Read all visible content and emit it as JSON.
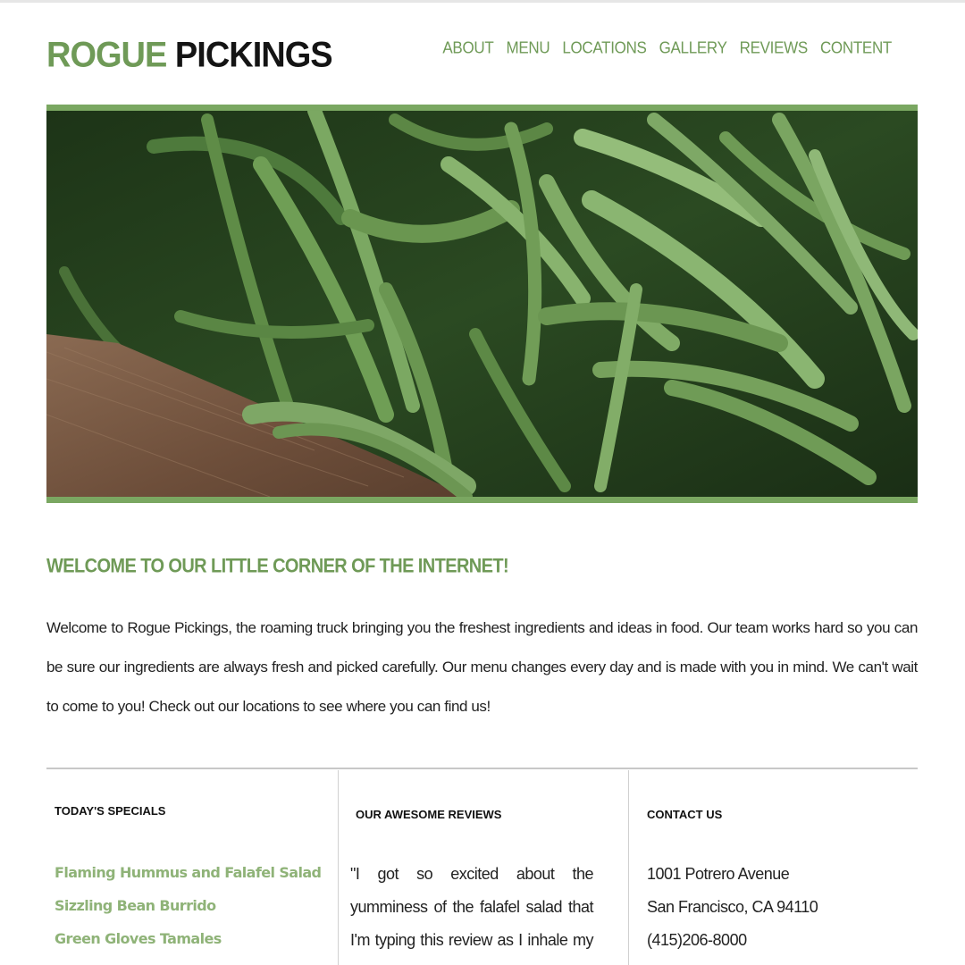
{
  "header": {
    "logo_part1": "ROGUE",
    "logo_part2": "PICKINGS",
    "nav": [
      "ABOUT",
      "MENU",
      "LOCATIONS",
      "GALLERY",
      "REVIEWS",
      "CONTENT"
    ]
  },
  "hero": {
    "image": "green-beans-photo"
  },
  "welcome": {
    "heading": "WELCOME TO OUR LITTLE CORNER OF THE INTERNET!",
    "body": "Welcome to Rogue Pickings, the roaming truck bringing you the freshest ingredients and ideas in food. Our team works hard so you can be sure our ingredients are always fresh and picked carefully. Our menu changes every day and is made with you in mind. We can't wait to come to you! Check out our locations to see where you can find us!"
  },
  "specials": {
    "heading": "TODAY'S SPECIALS",
    "items": [
      "Flaming Hummus and Falafel Salad",
      "Sizzling Bean Burrido",
      "Green Gloves Tamales"
    ]
  },
  "reviews": {
    "heading": "OUR AWESOME REVIEWS",
    "text": "\"I got so excited about the yumminess of the falafel salad that I'm typing this review as I inhale my lunch. Yes, it is that good...Service"
  },
  "contact": {
    "heading": "CONTACT US",
    "address1": "1001 Potrero Avenue",
    "address2": "San Francisco, CA 94110",
    "phone": "(415)206-8000"
  },
  "colors": {
    "accent": "#6f9a57",
    "special_link": "#8fb378",
    "hero_border": "#7aa761"
  }
}
